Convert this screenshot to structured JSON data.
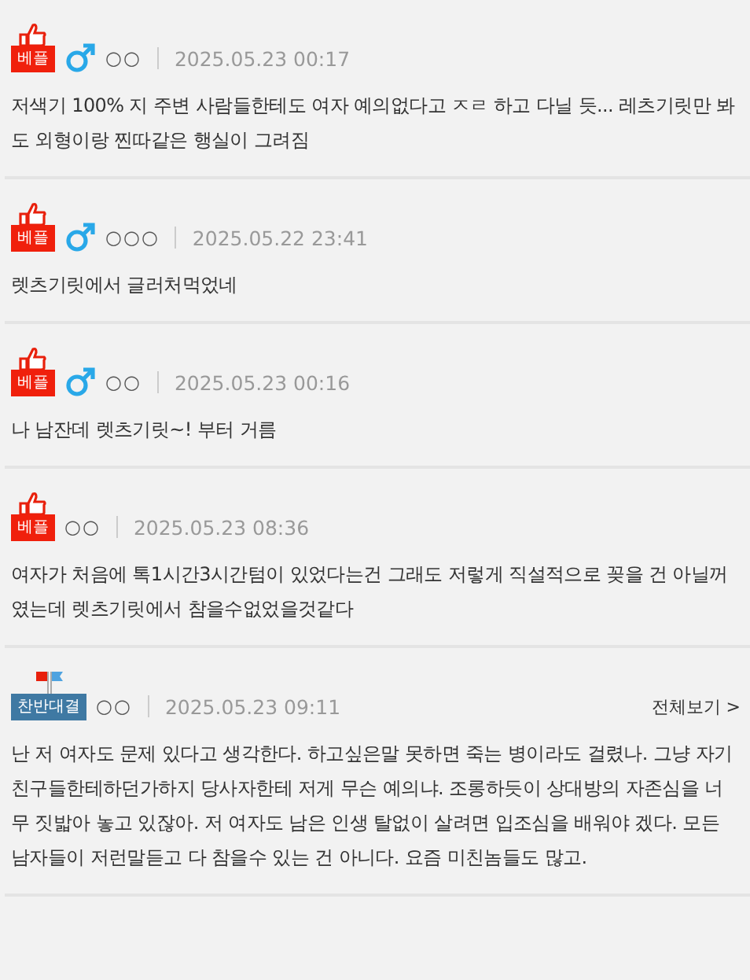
{
  "comments": [
    {
      "badge": {
        "kind": "best",
        "label": "베플"
      },
      "male": true,
      "author": "○○",
      "date": "2025.05.23 00:17",
      "text": "저색기 100% 지 주변 사람들한테도 여자 예의없다고 ㅈㄹ 하고 다닐 듯... 레츠기릿만 봐도 외형이랑 찐따같은 행실이 그려짐"
    },
    {
      "badge": {
        "kind": "best",
        "label": "베플"
      },
      "male": true,
      "author": "○○○",
      "date": "2025.05.22 23:41",
      "text": "렛츠기릿에서 글러처먹었네"
    },
    {
      "badge": {
        "kind": "best",
        "label": "베플"
      },
      "male": true,
      "author": "○○",
      "date": "2025.05.23 00:16",
      "text": "나 남잔데 렛츠기릿~! 부터 거름"
    },
    {
      "badge": {
        "kind": "best",
        "label": "베플"
      },
      "male": false,
      "author": "○○",
      "date": "2025.05.23 08:36",
      "text": "여자가 처음에 톡1시간3시간텀이 있었다는건 그래도 저렇게 직설적으로 꽂을 건 아닐꺼였는데 렛츠기릿에서 참을수없었을것같다"
    },
    {
      "badge": {
        "kind": "debate",
        "label": "찬반대결"
      },
      "male": false,
      "author": "○○",
      "date": "2025.05.23 09:11",
      "more": "전체보기 >",
      "text": "난 저 여자도 문제 있다고 생각한다. 하고싶은말 못하면 죽는 병이라도 걸렸나. 그냥 자기 친구들한테하던가하지 당사자한테 저게 무슨 예의냐. 조롱하듯이 상대방의 자존심을 너무 짓밟아 놓고 있잖아. 저 여자도 남은 인생 탈없이 살려면 입조심을 배워야 겠다. 모든 남자들이 저런말듣고 다 참을수 있는 건 아니다. 요즘 미친놈들도 많고."
    }
  ]
}
